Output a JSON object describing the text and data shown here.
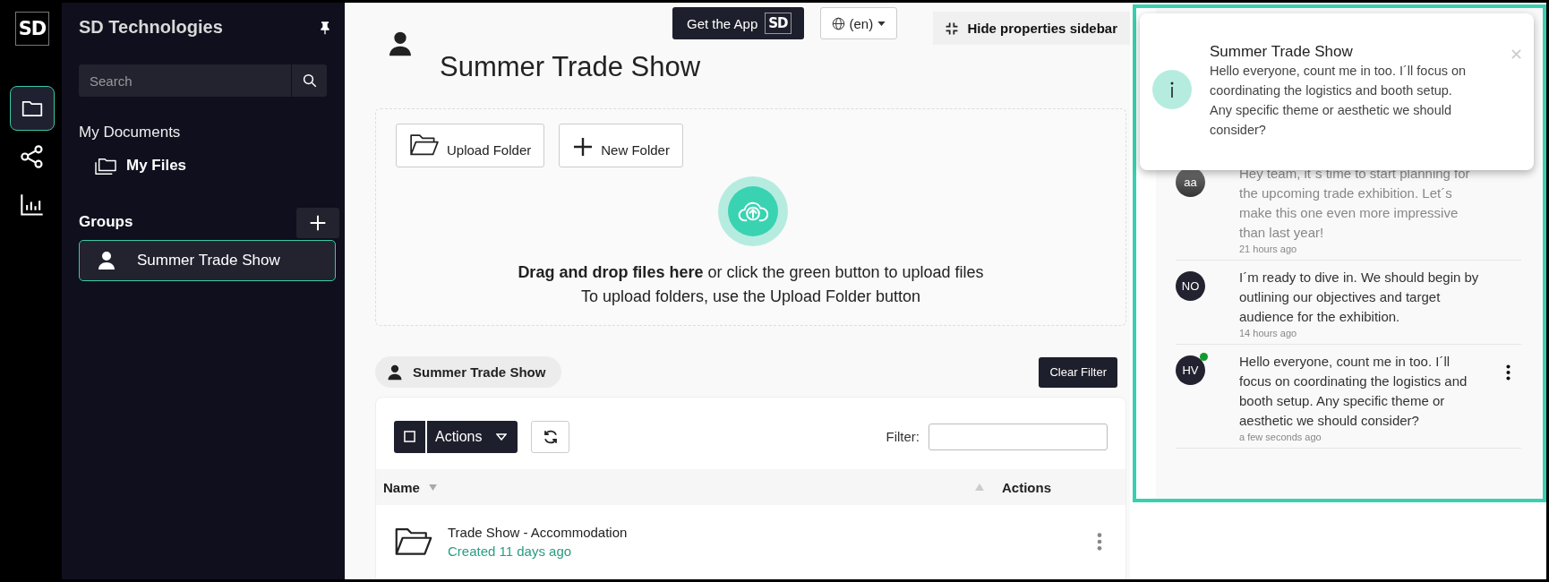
{
  "rail": {
    "logo": "SD",
    "items": [
      {
        "kind": "folder",
        "selected": true
      },
      {
        "kind": "share",
        "selected": false
      },
      {
        "kind": "chart",
        "selected": false
      }
    ]
  },
  "sidebar": {
    "title": "SD Technologies",
    "search": {
      "placeholder": "Search"
    },
    "section": "My Documents",
    "my_files": "My Files",
    "groups_label": "Groups",
    "groups": [
      {
        "label": "Summer Trade Show",
        "selected": true
      }
    ]
  },
  "topbar": {
    "get_app": "Get the App",
    "app_badge": "SD",
    "language": "(en)",
    "hide_sidebar": "Hide properties sidebar"
  },
  "page_title": "Summer Trade Show",
  "upload": {
    "buttons": [
      {
        "kind": "upload",
        "label": "Upload Folder"
      },
      {
        "kind": "new",
        "label": "New Folder"
      }
    ],
    "drop_text": "**Drag and drop files here**  or click the green button to upload files",
    "folder_hint": "To upload folders, use the Upload Folder button"
  },
  "filter_chip": "Summer Trade Show",
  "clear_filter": "Clear Filter",
  "table": {
    "select_all": {
      "checked": false
    },
    "actions_button": "Actions",
    "filter_label": "Filter:",
    "columns": [
      "Name",
      "Actions"
    ],
    "rows": [
      {
        "name": "Trade Show - Accommodation",
        "created": "Created 11 days ago"
      }
    ]
  },
  "messages": [
    {
      "initials": "aa",
      "text": "Hey team, it´s time to start planning for the upcoming trade exhibition. Let´s make this one even more impressive than last year!",
      "time": "21 hours ago",
      "online": false,
      "show_menu": false
    },
    {
      "initials": "NO",
      "text": "I´m ready to dive in. We should begin by outlining our objectives and target audience for the exhibition.",
      "time": "14 hours ago",
      "online": false,
      "show_menu": false
    },
    {
      "initials": "HV",
      "text": "Hello everyone, count me in too. I´ll focus on coordinating the logistics and booth setup. Any specific theme or aesthetic we should consider?",
      "time": "a few seconds ago",
      "online": true,
      "show_menu": true
    }
  ],
  "toast": {
    "title": "Summer Trade Show",
    "text": "Hello everyone, count me in too. I´ll focus on coordinating the logistics and booth setup. Any specific theme or aesthetic we should consider?"
  }
}
